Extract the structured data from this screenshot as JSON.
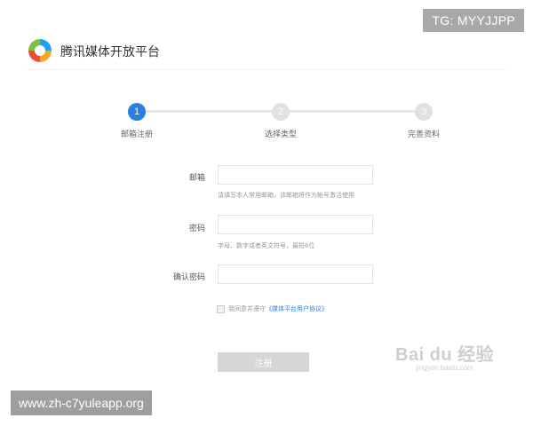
{
  "overlay_tag": "TG: MYYJJPP",
  "header": {
    "brand": "腾讯媒体开放平台",
    "logo_icon": "tencent-logo-icon"
  },
  "steps": [
    {
      "number": "1",
      "label": "邮箱注册",
      "state": "active"
    },
    {
      "number": "2",
      "label": "选择类型",
      "state": "inactive"
    },
    {
      "number": "3",
      "label": "完善资料",
      "state": "inactive"
    }
  ],
  "form": {
    "email_label": "邮箱",
    "email_value": "",
    "email_hint": "请填写本人常用邮箱，该邮箱将作为帐号激活使用",
    "password_label": "密码",
    "password_value": "",
    "password_hint": "字母、数字或者英文符号，最短6位",
    "confirm_label": "确认密码",
    "confirm_value": "",
    "agree_text": "我同意并遵守",
    "agree_link": "《媒体平台用户协议》",
    "agree_checked": false,
    "submit_label": "注册"
  },
  "watermark": {
    "main": "Bai du 经验",
    "sub": "jingyan.baidu.com"
  },
  "footer_url": "www.zh-c7yuleapp.org",
  "colors": {
    "accent": "#2a7fe0",
    "inactive_step": "#e1e1e1",
    "button_disabled": "#d6d6d6"
  }
}
